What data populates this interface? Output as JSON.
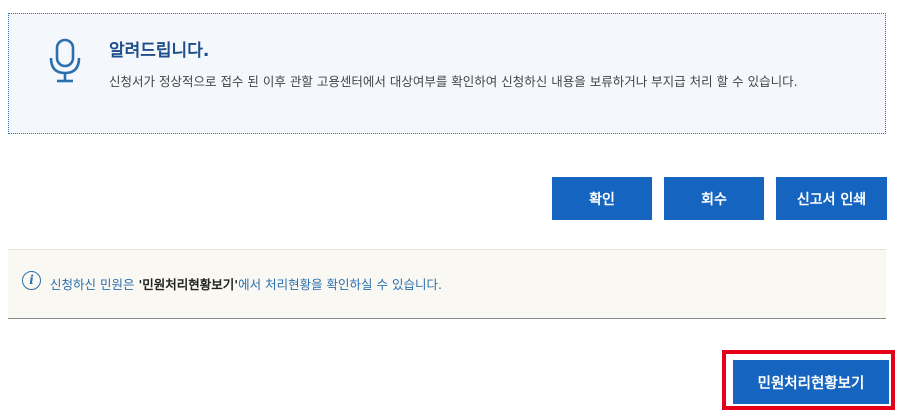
{
  "notice": {
    "icon": "microphone-icon",
    "title": "알려드립니다.",
    "body": "신청서가 정상적으로 접수 된 이후 관할 고용센터에서 대상여부를 확인하여 신청하신 내용을 보류하거나 부지급 처리 할 수 있습니다."
  },
  "actions": {
    "confirm_label": "확인",
    "withdraw_label": "회수",
    "print_label": "신고서 인쇄"
  },
  "info": {
    "icon": "info-icon",
    "icon_glyph": "i",
    "text_before": "신청하신 민원은 ",
    "text_emphasis": "'민원처리현황보기'",
    "text_after": "에서 처리현황을 확인하실 수 있습니다."
  },
  "footer": {
    "status_button_label": "민원처리현황보기"
  },
  "colors": {
    "primary_button": "#1565c0",
    "notice_title": "#1e4f8a",
    "info_text": "#2c6fae",
    "highlight": "#e4001a"
  }
}
